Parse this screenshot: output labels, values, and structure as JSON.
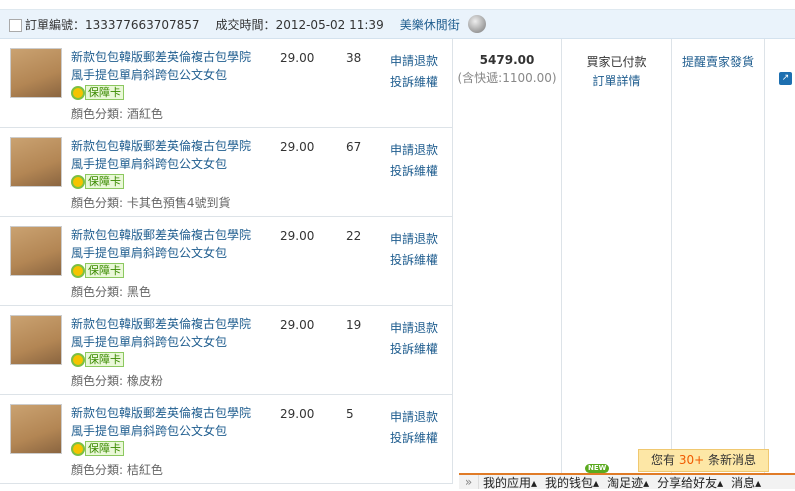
{
  "order": {
    "number_label": "訂單編號：",
    "number": "133377663707857",
    "time_label": "成交時間：",
    "time": "2012-05-02 11:39",
    "shop": "美樂休閒街"
  },
  "items": [
    {
      "title": "新款包包韓版郵差英倫複古包學院風手提包單肩斜跨包公文女包",
      "badge": "保障卡",
      "sku": "顏色分類: 酒紅色",
      "price": "29.00",
      "qty": "38",
      "refund": "申請退款",
      "complain": "投訴維權"
    },
    {
      "title": "新款包包韓版郵差英倫複古包學院風手提包單肩斜跨包公文女包",
      "badge": "保障卡",
      "sku": "顏色分類: 卡其色預售4號到貨",
      "price": "29.00",
      "qty": "67",
      "refund": "申請退款",
      "complain": "投訴維權"
    },
    {
      "title": "新款包包韓版郵差英倫複古包學院風手提包單肩斜跨包公文女包",
      "badge": "保障卡",
      "sku": "顏色分類: 黑色",
      "price": "29.00",
      "qty": "22",
      "refund": "申請退款",
      "complain": "投訴維權"
    },
    {
      "title": "新款包包韓版郵差英倫複古包學院風手提包單肩斜跨包公文女包",
      "badge": "保障卡",
      "sku": "顏色分類: 橡皮粉",
      "price": "29.00",
      "qty": "19",
      "refund": "申請退款",
      "complain": "投訴維權"
    },
    {
      "title": "新款包包韓版郵差英倫複古包學院風手提包單肩斜跨包公文女包",
      "badge": "保障卡",
      "sku": "顏色分類: 桔紅色",
      "price": "29.00",
      "qty": "5",
      "refund": "申請退款",
      "complain": "投訴維權"
    }
  ],
  "total": {
    "amount": "5479.00",
    "shipping": "(含快遞:1100.00)"
  },
  "status": {
    "text": "買家已付款",
    "detail": "訂單詳情"
  },
  "action": {
    "remind": "提醒賣家發貨"
  },
  "notice": {
    "prefix": "您有 ",
    "count": "30+",
    "suffix": " 条新消息"
  },
  "toolbar": {
    "expand": "»",
    "items": [
      "我的应用▴",
      "我的钱包▴",
      "淘足迹▴",
      "分享给好友▴",
      "消息▴"
    ],
    "new_badge": "NEW"
  }
}
